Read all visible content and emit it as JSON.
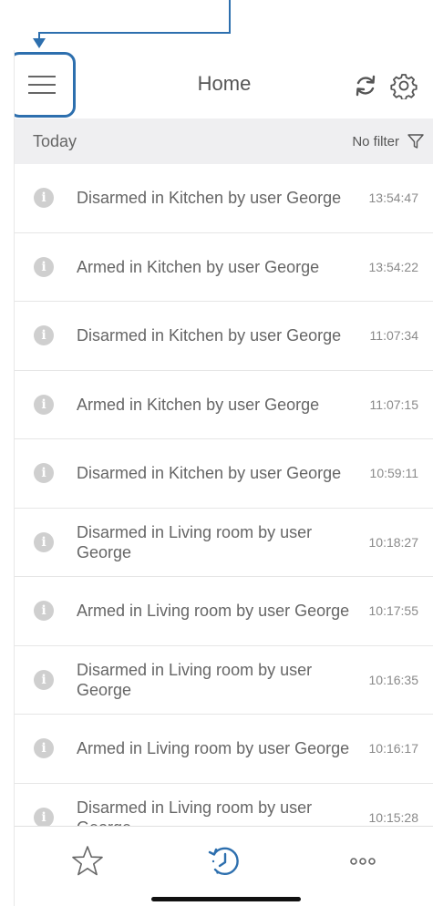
{
  "header": {
    "title": "Home",
    "menu_icon": "hamburger-menu-icon",
    "refresh_icon": "refresh-icon",
    "settings_icon": "gear-icon"
  },
  "section": {
    "title": "Today",
    "filter_label": "No filter",
    "filter_icon": "funnel-icon"
  },
  "events": [
    {
      "text": "Disarmed in Kitchen by user George",
      "time": "13:54:47"
    },
    {
      "text": "Armed in Kitchen by user George",
      "time": "13:54:22"
    },
    {
      "text": "Disarmed in Kitchen by user George",
      "time": "11:07:34"
    },
    {
      "text": "Armed in Kitchen by user George",
      "time": "11:07:15"
    },
    {
      "text": "Disarmed in Kitchen by user George",
      "time": "10:59:11"
    },
    {
      "text": "Disarmed in Living room by user George",
      "time": "10:18:27"
    },
    {
      "text": "Armed in Living room by user George",
      "time": "10:17:55"
    },
    {
      "text": "Disarmed in Living room by user George",
      "time": "10:16:35"
    },
    {
      "text": "Armed in Living room by user George",
      "time": "10:16:17"
    },
    {
      "text": "Disarmed in Living room by user George",
      "time": "10:15:28"
    }
  ],
  "tabbar": {
    "favorites_icon": "star-icon",
    "history_icon": "history-clock-icon",
    "more_icon": "more-dots-icon"
  },
  "colors": {
    "accent": "#2d6fae",
    "section_bg": "#efeff1",
    "info_icon": "#cfcfcf"
  }
}
